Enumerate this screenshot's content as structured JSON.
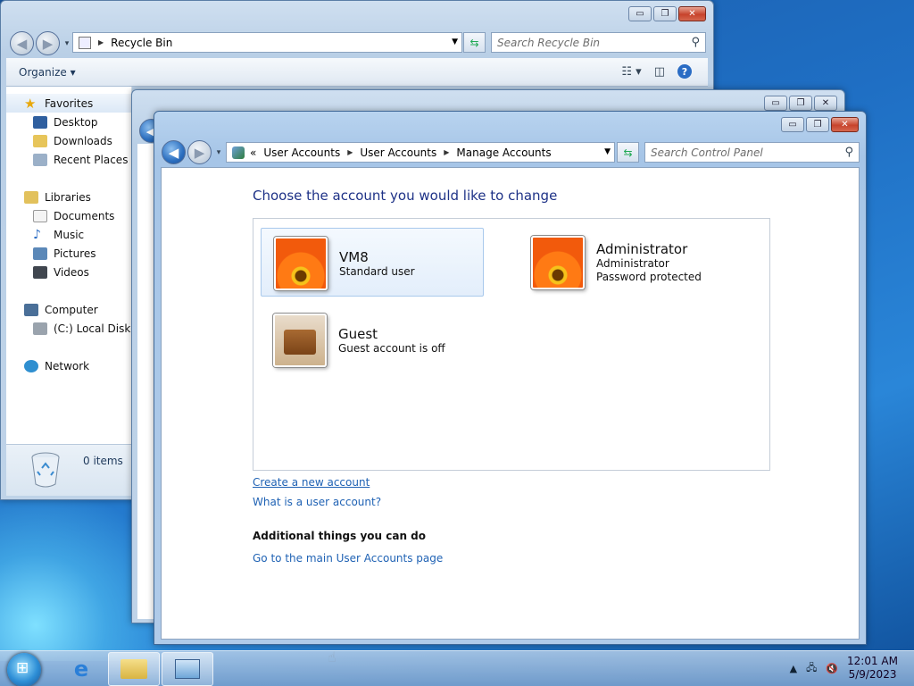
{
  "explorer": {
    "address": "Recycle Bin",
    "search_placeholder": "Search Recycle Bin",
    "organize_label": "Organize",
    "nav": {
      "favorites": "Favorites",
      "desktop": "Desktop",
      "downloads": "Downloads",
      "recent_places": "Recent Places",
      "libraries": "Libraries",
      "documents": "Documents",
      "music": "Music",
      "pictures": "Pictures",
      "videos": "Videos",
      "computer": "Computer",
      "local_disk": "(C:) Local Disk",
      "network": "Network"
    },
    "details_count": "0 items"
  },
  "control_panel": {
    "breadcrumb": [
      "User Accounts",
      "User Accounts",
      "Manage Accounts"
    ],
    "breadcrumb_prefix": "«",
    "search_placeholder": "Search Control Panel",
    "heading": "Choose the account you would like to change",
    "accounts": [
      {
        "name": "VM8",
        "line1": "Standard user",
        "line2": ""
      },
      {
        "name": "Administrator",
        "line1": "Administrator",
        "line2": "Password protected"
      },
      {
        "name": "Guest",
        "line1": "Guest account is off",
        "line2": ""
      }
    ],
    "links": {
      "create": "Create a new account",
      "what_is": "What is a user account?",
      "main_page": "Go to the main User Accounts page"
    },
    "additional_heading": "Additional things you can do"
  },
  "window_controls": {
    "minimize": "▭",
    "maximize": "❐",
    "close": "✕"
  },
  "taskbar": {
    "time": "12:01 AM",
    "date": "5/9/2023"
  },
  "icons": {
    "favorites": "star-icon",
    "recycle_bin": "recycle-bin-icon",
    "user_accounts": "user-accounts-icon"
  }
}
